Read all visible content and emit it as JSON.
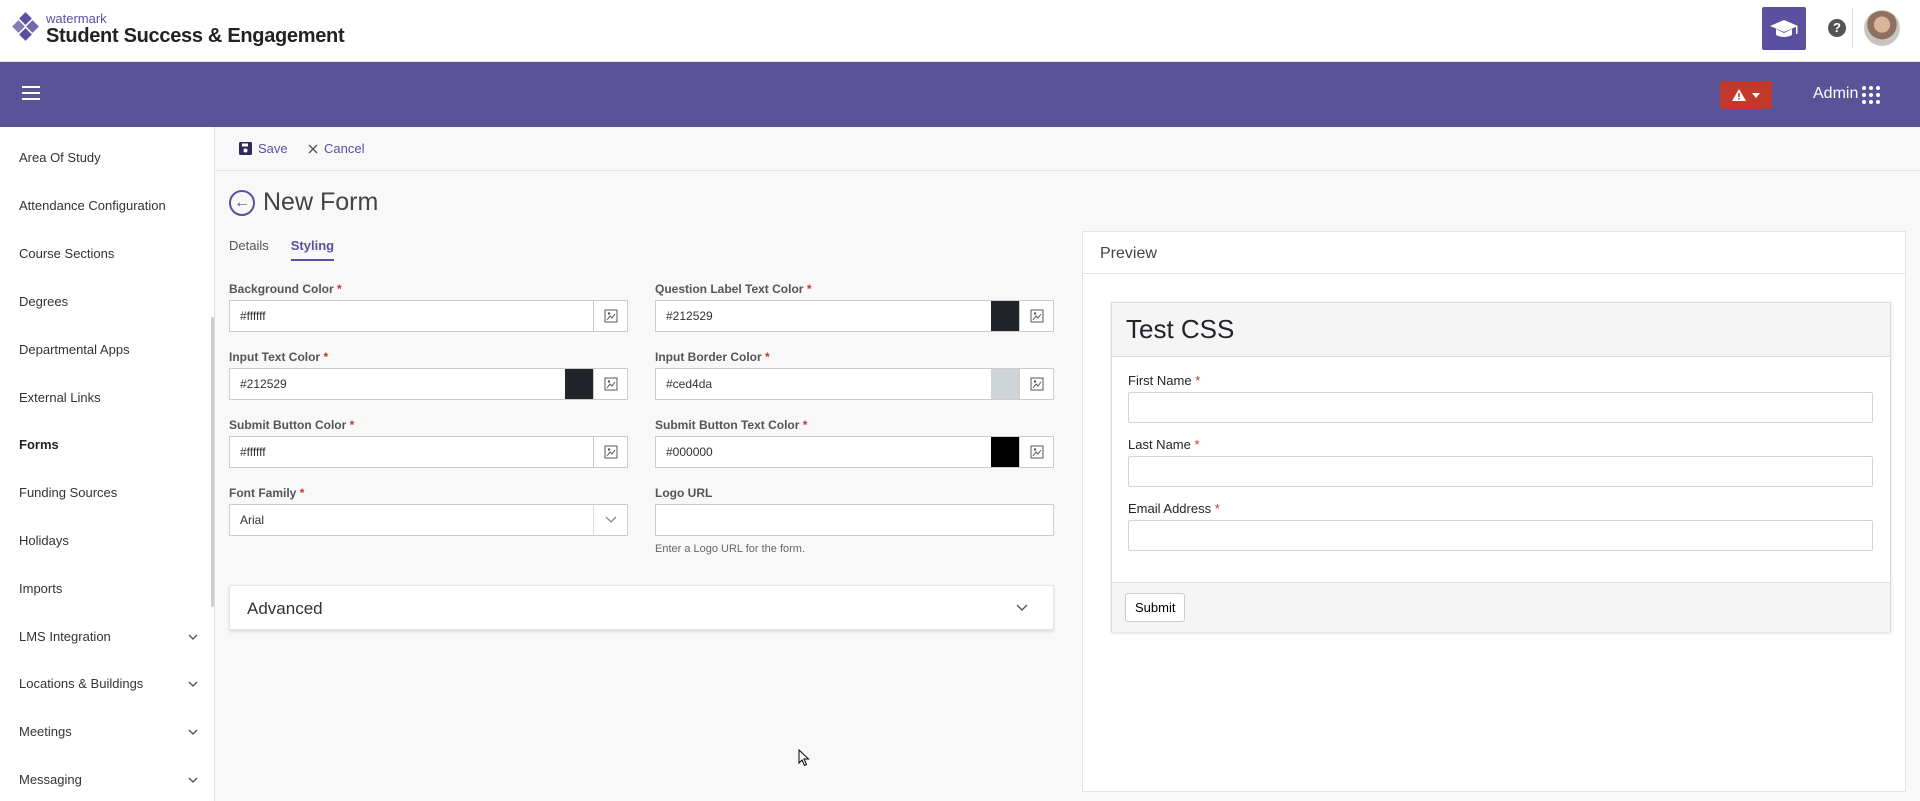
{
  "header": {
    "brand_small": "watermark",
    "brand_title": "Student Success & Engagement",
    "icons": [
      "graduation-cap-icon",
      "help-icon",
      "avatar"
    ]
  },
  "navbar": {
    "admin_label": "Admin",
    "accent_color": "#5b5397",
    "alert_color": "#c0392b"
  },
  "sidebar": {
    "items": [
      {
        "label": "Area Of Study",
        "expandable": false
      },
      {
        "label": "Attendance Configuration",
        "expandable": false
      },
      {
        "label": "Course Sections",
        "expandable": false
      },
      {
        "label": "Degrees",
        "expandable": false
      },
      {
        "label": "Departmental Apps",
        "expandable": false
      },
      {
        "label": "External Links",
        "expandable": false
      },
      {
        "label": "Forms",
        "expandable": false,
        "active": true
      },
      {
        "label": "Funding Sources",
        "expandable": false
      },
      {
        "label": "Holidays",
        "expandable": false
      },
      {
        "label": "Imports",
        "expandable": false
      },
      {
        "label": "LMS Integration",
        "expandable": true
      },
      {
        "label": "Locations & Buildings",
        "expandable": true
      },
      {
        "label": "Meetings",
        "expandable": true
      },
      {
        "label": "Messaging",
        "expandable": true
      }
    ]
  },
  "toolbar": {
    "save_label": "Save",
    "cancel_label": "Cancel"
  },
  "page": {
    "title": "New Form",
    "tabs": [
      {
        "label": "Details",
        "active": false
      },
      {
        "label": "Styling",
        "active": true
      }
    ]
  },
  "styling": {
    "background_color": {
      "label": "Background Color",
      "value": "#ffffff"
    },
    "question_label_text_color": {
      "label": "Question Label Text Color",
      "value": "#212529"
    },
    "input_text_color": {
      "label": "Input Text Color",
      "value": "#212529"
    },
    "input_border_color": {
      "label": "Input Border Color",
      "value": "#ced4da"
    },
    "submit_button_color": {
      "label": "Submit Button Color",
      "value": "#ffffff"
    },
    "submit_button_text_color": {
      "label": "Submit Button Text Color",
      "value": "#000000"
    },
    "font_family": {
      "label": "Font Family",
      "value": "Arial"
    },
    "logo_url": {
      "label": "Logo URL",
      "value": "",
      "helper": "Enter a Logo URL for the form."
    },
    "required_mark": "*"
  },
  "advanced": {
    "title": "Advanced"
  },
  "preview": {
    "title": "Preview",
    "form_title": "Test CSS",
    "fields": [
      {
        "label": "First Name",
        "required": true
      },
      {
        "label": "Last Name",
        "required": true
      },
      {
        "label": "Email Address",
        "required": true
      }
    ],
    "submit_label": "Submit"
  }
}
